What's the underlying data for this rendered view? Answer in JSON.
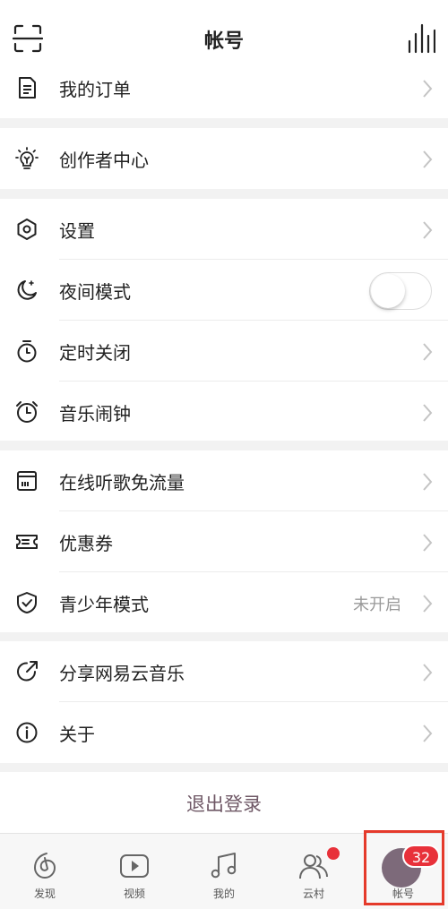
{
  "header": {
    "title": "帐号",
    "scan_icon": "scan-icon",
    "stats_icon": "bars-icon"
  },
  "sections": {
    "orders": {
      "label": "我的订单",
      "icon": "document-icon"
    },
    "creator": {
      "label": "创作者中心",
      "icon": "bulb-icon"
    },
    "settings": {
      "label": "设置",
      "icon": "hexagon-icon"
    },
    "night": {
      "label": "夜间模式",
      "icon": "moon-icon",
      "on": false
    },
    "timer": {
      "label": "定时关闭",
      "icon": "stopwatch-icon"
    },
    "alarm": {
      "label": "音乐闹钟",
      "icon": "alarm-icon"
    },
    "traffic": {
      "label": "在线听歌免流量",
      "icon": "card-icon"
    },
    "coupon": {
      "label": "优惠券",
      "icon": "ticket-icon"
    },
    "teen": {
      "label": "青少年模式",
      "icon": "shield-icon",
      "value": "未开启"
    },
    "share": {
      "label": "分享网易云音乐",
      "icon": "share-icon"
    },
    "about": {
      "label": "关于",
      "icon": "info-icon"
    }
  },
  "logout": {
    "label": "退出登录"
  },
  "tabs": {
    "discover": {
      "label": "发现"
    },
    "video": {
      "label": "视频"
    },
    "mine": {
      "label": "我的"
    },
    "village": {
      "label": "云村"
    },
    "account": {
      "label": "帐号",
      "badge": "32"
    }
  },
  "colors": {
    "accent": "#e8313a",
    "highlight": "#e53a2b",
    "logout": "#6f5866"
  }
}
